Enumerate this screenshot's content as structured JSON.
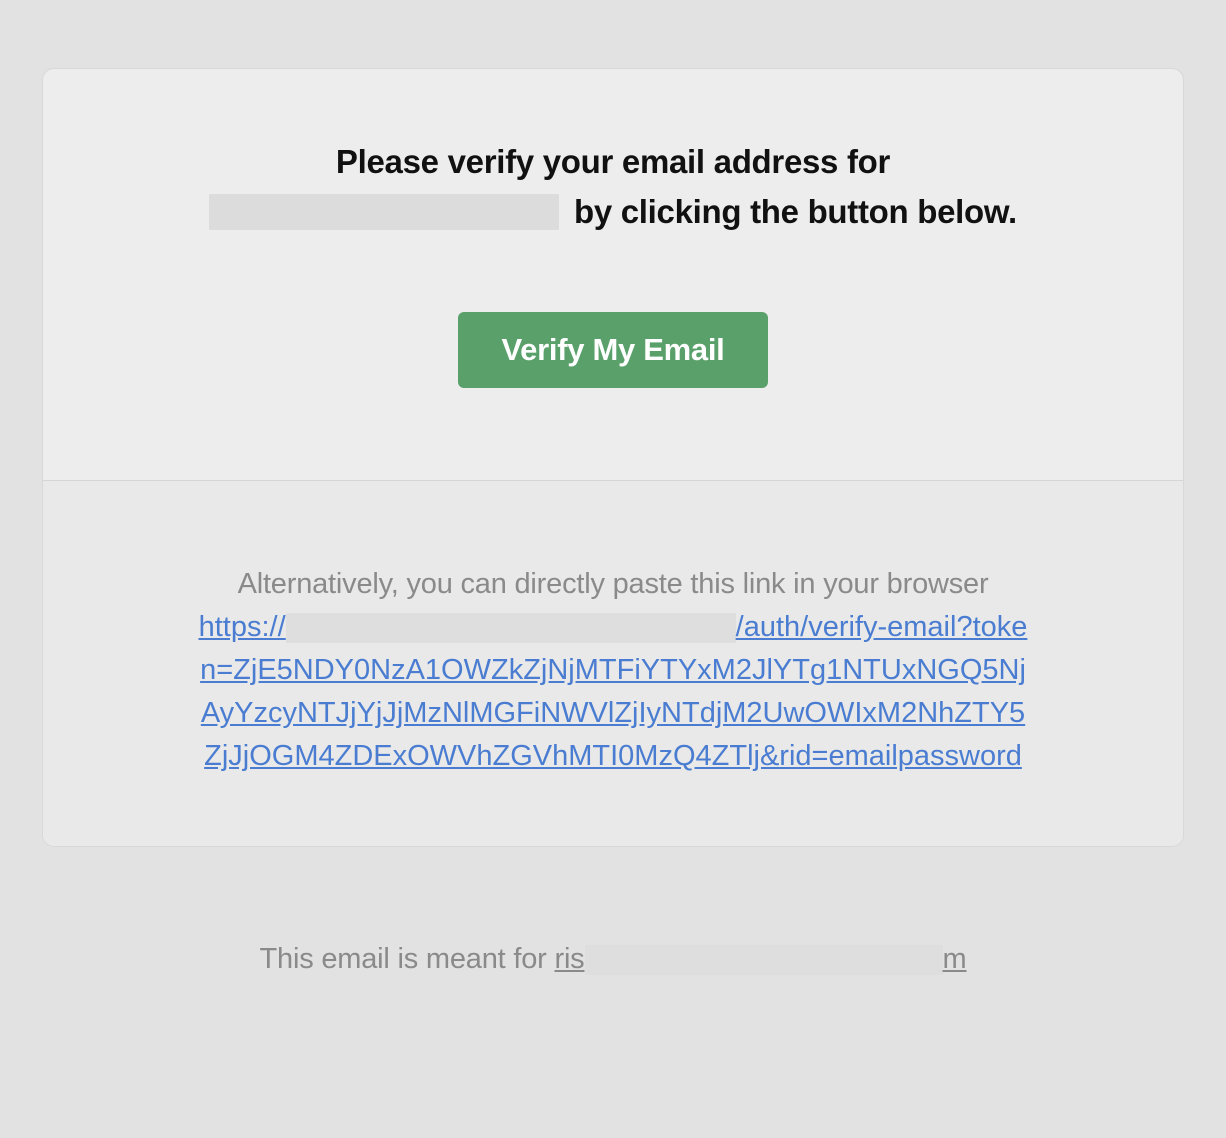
{
  "heading": {
    "part1": "Please verify your email address for ",
    "part2": "by clicking the button below."
  },
  "button": {
    "label": "Verify My Email"
  },
  "alternative": {
    "text": "Alternatively, you can directly paste this link in your browser",
    "link_prefix": "https://",
    "link_suffix": "/auth/verify-email?token=ZjE5NDY0NzA1OWZkZjNjMTFiYTYxM2JlYTg1NTUxNGQ5NjAyYzcyNTJjYjJjMzNlMGFiNWVlZjIyNTdjM2UwOWIxM2NhZTY5ZjJjOGM4ZDExOWVhZGVhMTI0MzQ4ZTlj&rid=emailpassword"
  },
  "footer": {
    "prefix": "This email is meant for ",
    "name_visible_start": "ris",
    "name_visible_end": "m"
  }
}
